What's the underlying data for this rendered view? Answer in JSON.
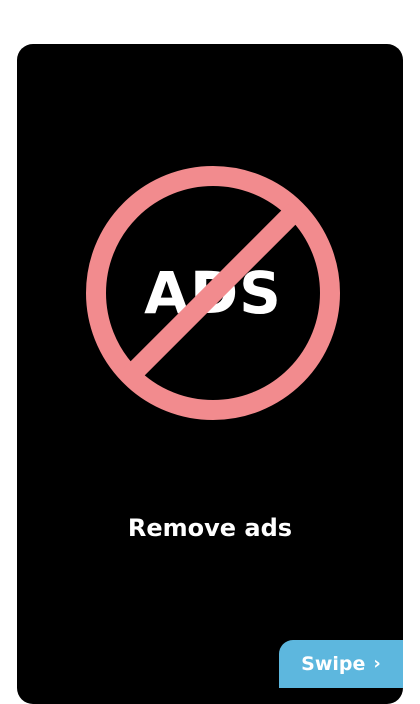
{
  "card": {
    "graphic_text": "ADS",
    "title": "Remove ads"
  },
  "swipe": {
    "label": "Swipe",
    "icon": "chevron-right-icon",
    "glyph": "›"
  },
  "colors": {
    "card_background": "#000000",
    "prohibition": "#f28b8e",
    "swipe_background": "#5db7de",
    "text": "#ffffff"
  }
}
